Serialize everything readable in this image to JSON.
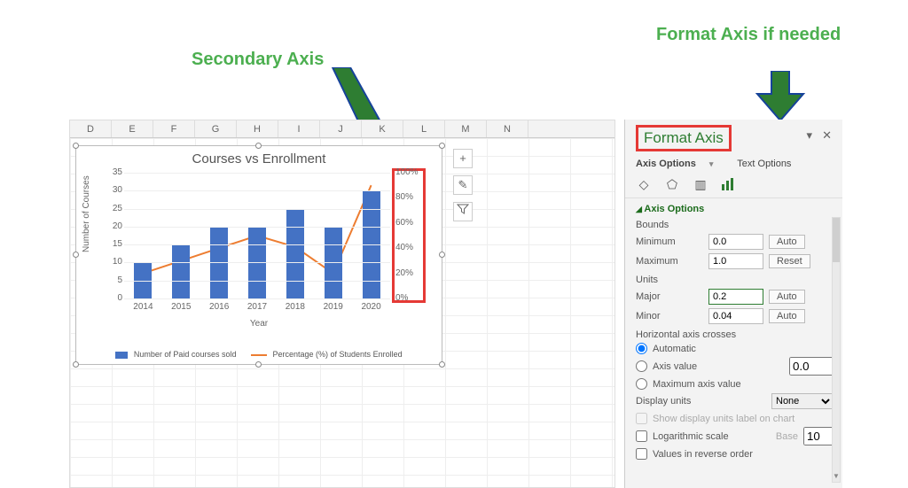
{
  "annotations": {
    "top_left": "Secondary Axis",
    "top_right": "Format Axis if needed"
  },
  "columns": [
    "D",
    "E",
    "F",
    "G",
    "H",
    "I",
    "J",
    "K",
    "L",
    "M",
    "N"
  ],
  "chart_tools": {
    "plus": "+",
    "brush": "✎",
    "filter": "▾"
  },
  "chart_data": {
    "type": "bar+line",
    "title": "Courses vs Enrollment",
    "xlabel": "Year",
    "ylabel": "Number of Courses",
    "ylim": [
      0,
      35
    ],
    "y2lim": [
      0,
      1.0
    ],
    "categories": [
      "2014",
      "2015",
      "2016",
      "2017",
      "2018",
      "2019",
      "2020"
    ],
    "series": [
      {
        "name": "Number of Paid courses sold",
        "type": "bar",
        "axis": "primary",
        "values": [
          10,
          15,
          20,
          20,
          25,
          20,
          30
        ]
      },
      {
        "name": "Percentage (%) of Students Enrolled",
        "type": "line",
        "axis": "secondary",
        "values": [
          0.2,
          0.3,
          0.4,
          0.5,
          0.41,
          0.2,
          0.9
        ]
      }
    ],
    "y_ticks": [
      "0",
      "5",
      "10",
      "15",
      "20",
      "25",
      "30",
      "35"
    ],
    "y2_ticks": [
      "0%",
      "20%",
      "40%",
      "60%",
      "80%",
      "100%"
    ]
  },
  "pane": {
    "title": "Format Axis",
    "tab_axis_options": "Axis Options",
    "tab_text_options": "Text Options",
    "section_axis_options": "Axis Options",
    "bounds": {
      "label": "Bounds",
      "min_label": "Minimum",
      "min_value": "0.0",
      "min_btn": "Auto",
      "max_label": "Maximum",
      "max_value": "1.0",
      "max_btn": "Reset"
    },
    "units": {
      "label": "Units",
      "major_label": "Major",
      "major_value": "0.2",
      "major_btn": "Auto",
      "minor_label": "Minor",
      "minor_value": "0.04",
      "minor_btn": "Auto"
    },
    "hcross": {
      "label": "Horizontal axis crosses",
      "auto": "Automatic",
      "axis_value": "Axis value",
      "axis_value_val": "0.0",
      "max": "Maximum axis value"
    },
    "display_units": {
      "label": "Display units",
      "value": "None",
      "show_label": "Show display units label on chart"
    },
    "log": {
      "label": "Logarithmic scale",
      "base_label": "Base",
      "base_value": "10"
    },
    "reverse": "Values in reverse order"
  }
}
